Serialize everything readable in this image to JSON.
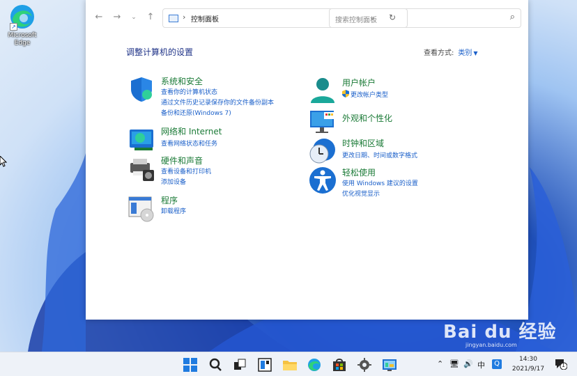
{
  "desktop": {
    "icon_label": "Microsoft Edge"
  },
  "window": {
    "address_path": "控制面板",
    "search_placeholder": "搜索控制面板",
    "page_title": "调整计算机的设置",
    "view_by_label": "查看方式:",
    "view_by_value": "类别"
  },
  "categories": [
    {
      "title": "系统和安全",
      "links": [
        "查看你的计算机状态",
        "通过文件历史记录保存你的文件备份副本",
        "备份和还原(Windows 7)"
      ],
      "icon": "shield-icon"
    },
    {
      "title": "网络和 Internet",
      "links": [
        "查看网络状态和任务"
      ],
      "icon": "network-icon"
    },
    {
      "title": "硬件和声音",
      "links": [
        "查看设备和打印机",
        "添加设备"
      ],
      "icon": "printer-icon"
    },
    {
      "title": "程序",
      "links": [
        "卸载程序"
      ],
      "icon": "programs-icon"
    },
    {
      "title": "用户帐户",
      "links": [
        "更改帐户类型"
      ],
      "icon": "user-icon"
    },
    {
      "title": "外观和个性化",
      "links": [],
      "icon": "monitor-icon"
    },
    {
      "title": "时钟和区域",
      "links": [
        "更改日期、时间或数字格式"
      ],
      "icon": "clock-globe-icon"
    },
    {
      "title": "轻松使用",
      "links": [
        "使用 Windows 建议的设置",
        "优化视觉显示"
      ],
      "icon": "accessibility-icon"
    }
  ],
  "taskbar": {
    "time": "14:30",
    "date": "2021/9/17",
    "notification_count": "1"
  },
  "watermark": {
    "main": "Bai du 经验",
    "sub": "jingyan.baidu.com"
  },
  "colors": {
    "link": "#1a5fc9",
    "category_title": "#1a7a36",
    "page_title": "#1e3287"
  }
}
